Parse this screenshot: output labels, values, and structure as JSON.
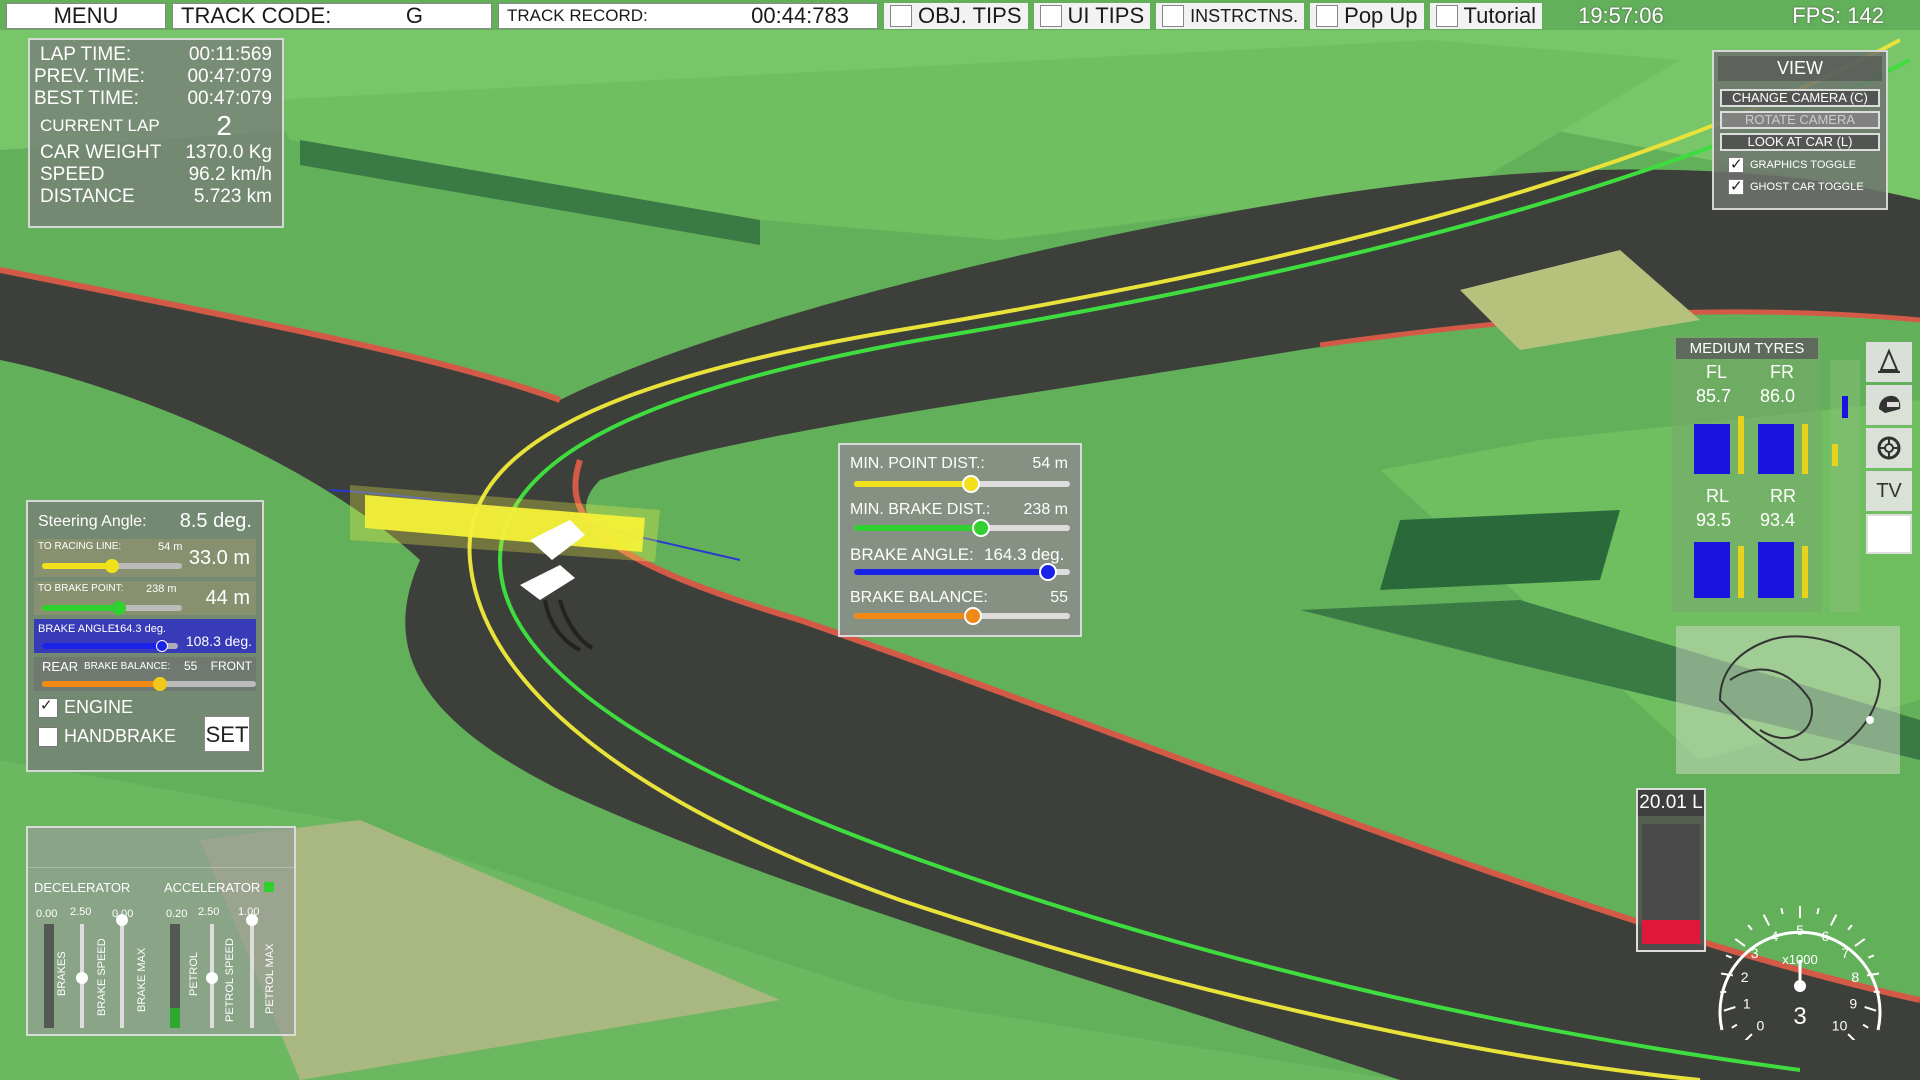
{
  "topbar": {
    "menu_label": "MENU",
    "track_code_label": "TRACK CODE:",
    "track_code_value": "G",
    "track_record_label": "TRACK RECORD:",
    "track_record_value": "00:44:783",
    "obj_tips_label": "OBJ. TIPS",
    "ui_tips_label": "UI  TIPS",
    "instructions_label": "INSTRCTNS.",
    "popup_label": "Pop Up",
    "tutorial_label": "Tutorial",
    "clock": "19:57:06",
    "fps": "FPS: 142"
  },
  "stats": {
    "lap_time_label": "LAP TIME:",
    "lap_time": "00:11:569",
    "prev_time_label": "PREV. TIME:",
    "prev_time": "00:47:079",
    "best_time_label": "BEST TIME:",
    "best_time": "00:47:079",
    "current_lap_label": "CURRENT LAP",
    "current_lap": "2",
    "car_weight_label": "CAR WEIGHT",
    "car_weight": "1370.0 Kg",
    "speed_label": "SPEED",
    "speed": "96.2 km/h",
    "distance_label": "DISTANCE",
    "distance": "5.723 km"
  },
  "view_panel": {
    "title": "VIEW",
    "change_camera": "CHANGE CAMERA (C)",
    "rotate_camera": "ROTATE CAMERA",
    "look_at_car": "LOOK AT CAR (L)",
    "graphics_toggle": "GRAPHICS TOGGLE",
    "ghost_car_toggle": "GHOST CAR TOGGLE"
  },
  "steering": {
    "angle_label": "Steering Angle:",
    "angle_value": "8.5 deg.",
    "racing_line_label": "TO RACING LINE:",
    "racing_line_small": "54 m",
    "racing_line_value": "33.0 m",
    "racing_line_pct": 0.5,
    "brake_point_label": "TO BRAKE POINT:",
    "brake_point_small": "238 m",
    "brake_point_value": "44 m",
    "brake_point_pct": 0.55,
    "brake_angle_label": "BRAKE ANGLE:",
    "brake_angle_small": "164.3 deg.",
    "brake_angle_value": "108.3 deg.",
    "brake_angle_pct": 0.88,
    "rear_label": "REAR",
    "brake_balance_label": "BRAKE BALANCE:",
    "brake_balance_small": "55",
    "front_label": "FRONT",
    "brake_balance_pct": 0.55,
    "engine_label": "ENGINE",
    "handbrake_label": "HANDBRAKE",
    "set_label": "SET"
  },
  "center_panel": {
    "min_point_label": "MIN. POINT DIST.:",
    "min_point_value": "54 m",
    "min_point_pct": 0.54,
    "min_brake_label": "MIN. BRAKE DIST.:",
    "min_brake_value": "238 m",
    "min_brake_pct": 0.59,
    "brake_angle_label": "BRAKE ANGLE:",
    "brake_angle_value": "164.3 deg.",
    "brake_angle_pct": 0.9,
    "brake_balance_label": "BRAKE BALANCE:",
    "brake_balance_value": "55",
    "brake_balance_pct": 0.55,
    "colors": {
      "min_point": "#f1e11a",
      "min_brake": "#2ed12e",
      "brake_angle": "#1b22e8",
      "brake_balance": "#f08a14"
    }
  },
  "tyres": {
    "title": "MEDIUM TYRES",
    "fl_label": "FL",
    "fl_value": "85.7",
    "fr_label": "FR",
    "fr_value": "86.0",
    "rl_label": "RL",
    "rl_value": "93.5",
    "rr_label": "RR",
    "rr_value": "93.4"
  },
  "camera_icons": [
    "cone-icon",
    "helmet-icon",
    "wheel-icon",
    "tv-icon",
    "blank-icon"
  ],
  "tv_label": "TV",
  "pedals": {
    "decelerator_label": "DECELERATOR",
    "accelerator_label": "ACCELERATOR",
    "brakes_value": "0.00",
    "brake_speed_value": "2.50",
    "brake_max_value": "0.00",
    "petrol_value": "0.20",
    "petrol_speed_value": "2.50",
    "petrol_max_value": "1.00",
    "brakes_label": "BRAKES",
    "brake_speed_label": "BRAKE SPEED",
    "brake_max_label": "BRAKE MAX",
    "petrol_label": "PETROL",
    "petrol_speed_label": "PETROL SPEED",
    "petrol_max_label": "PETROL MAX"
  },
  "fuel": {
    "value": "20.01 L",
    "level": 0.2
  },
  "tachometer": {
    "unit": "x1000",
    "gear": "3",
    "ticks": [
      "0",
      "1",
      "2",
      "3",
      "4",
      "5",
      "6",
      "7",
      "8",
      "9",
      "10"
    ]
  }
}
